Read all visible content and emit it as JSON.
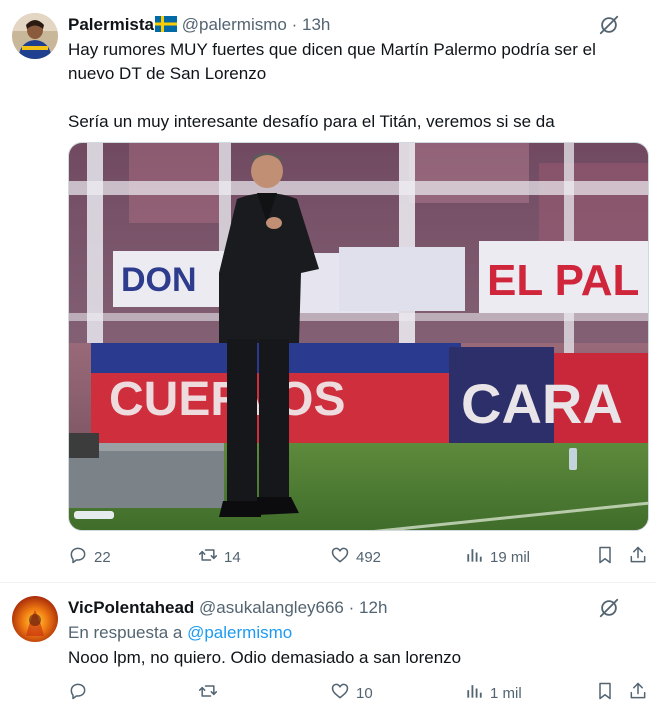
{
  "tweets": [
    {
      "name": "Palermista",
      "flag": "🇸🇪",
      "handle": "@palermismo",
      "sep": "·",
      "time": "13h",
      "text_line1": "Hay rumores MUY fuertes que dicen que Martín Palermo podría ser el",
      "text_line2": "nuevo DT de San Lorenzo",
      "text_line3": "Sería un muy interesante desafío para el Titán, veremos si se da",
      "media_banners": [
        "DON",
        "EL PAL",
        "CUERVOS",
        "CARA"
      ],
      "actions": {
        "replies": "22",
        "retweets": "14",
        "likes": "492",
        "views": "19 mil"
      }
    },
    {
      "name": "VicPolentahead",
      "handle": "@asukalangley666",
      "sep": "·",
      "time": "12h",
      "reply_prefix": "En respuesta a",
      "reply_handle": "@palermismo",
      "text_line1": "Nooo lpm, no quiero. Odio demasiado a san lorenzo",
      "actions": {
        "replies": "",
        "retweets": "",
        "likes": "10",
        "views": "1 mil"
      }
    }
  ],
  "colors": {
    "text": "#0f1419",
    "secondary": "#536471",
    "link": "#1d9bf0",
    "border": "#eff3f4"
  },
  "icons": [
    "grok-icon",
    "reply-icon",
    "retweet-icon",
    "like-icon",
    "views-icon",
    "bookmark-icon",
    "share-icon"
  ]
}
